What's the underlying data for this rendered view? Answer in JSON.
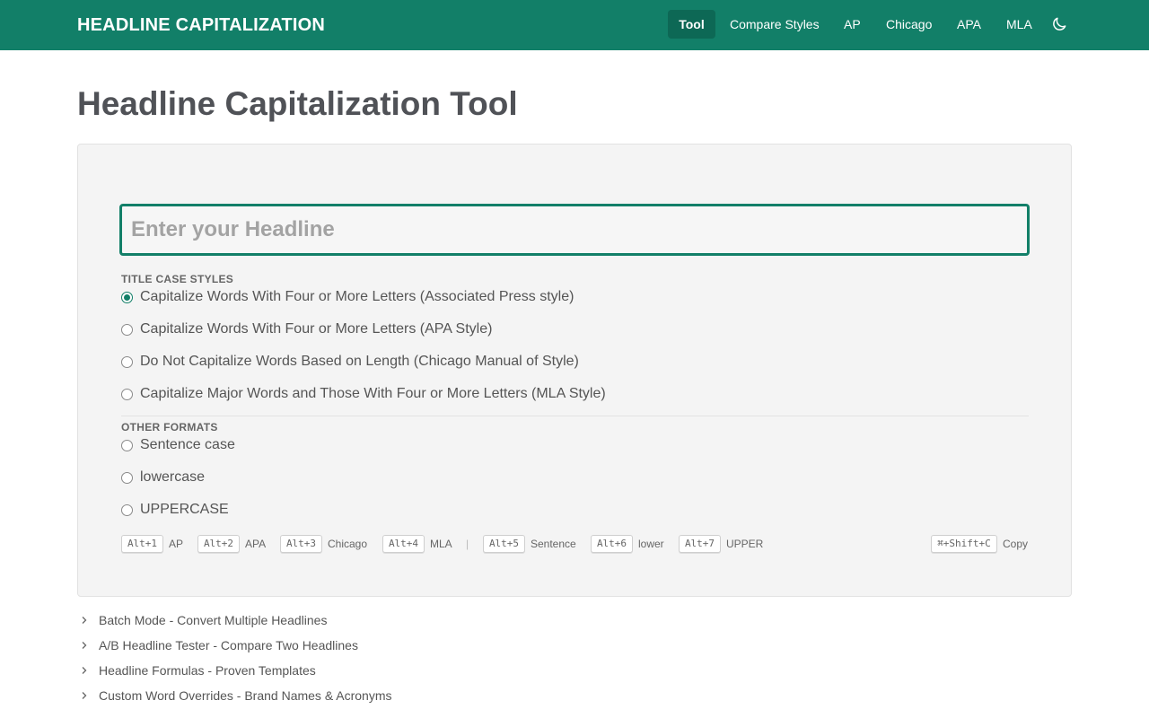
{
  "nav": {
    "brand": "HEADLINE CAPITALIZATION",
    "items": [
      {
        "label": "Tool",
        "active": true
      },
      {
        "label": "Compare Styles"
      },
      {
        "label": "AP"
      },
      {
        "label": "Chicago"
      },
      {
        "label": "APA"
      },
      {
        "label": "MLA"
      }
    ],
    "theme_toggle_icon": "moon-icon"
  },
  "page": {
    "title": "Headline Capitalization Tool"
  },
  "input": {
    "placeholder": "Enter your Headline",
    "value": ""
  },
  "title_case": {
    "heading": "TITLE CASE STYLES",
    "options": [
      {
        "label": "Capitalize Words With Four or More Letters (Associated Press style)",
        "checked": true
      },
      {
        "label": "Capitalize Words With Four or More Letters (APA Style)"
      },
      {
        "label": "Do Not Capitalize Words Based on Length (Chicago Manual of Style)"
      },
      {
        "label": "Capitalize Major Words and Those With Four or More Letters (MLA Style)"
      }
    ]
  },
  "other_formats": {
    "heading": "OTHER FORMATS",
    "options": [
      {
        "label": "Sentence case"
      },
      {
        "label": "lowercase"
      },
      {
        "label": "UPPERCASE"
      }
    ]
  },
  "shortcuts": {
    "items": [
      {
        "key": "Alt+1",
        "label": "AP"
      },
      {
        "key": "Alt+2",
        "label": "APA"
      },
      {
        "key": "Alt+3",
        "label": "Chicago"
      },
      {
        "key": "Alt+4",
        "label": "MLA"
      },
      {
        "key": "Alt+5",
        "label": "Sentence"
      },
      {
        "key": "Alt+6",
        "label": "lower"
      },
      {
        "key": "Alt+7",
        "label": "UPPER"
      }
    ],
    "separator": "|",
    "copy": {
      "key": "⌘+Shift+C",
      "label": "Copy"
    }
  },
  "sections": [
    {
      "label": "Batch Mode - Convert Multiple Headlines"
    },
    {
      "label": "A/B Headline Tester - Compare Two Headlines"
    },
    {
      "label": "Headline Formulas - Proven Templates"
    },
    {
      "label": "Custom Word Overrides - Brand Names & Acronyms"
    }
  ],
  "colors": {
    "brand": "#127f68",
    "brand_dark": "#0d6855",
    "panel_bg": "#f4f4f4"
  }
}
